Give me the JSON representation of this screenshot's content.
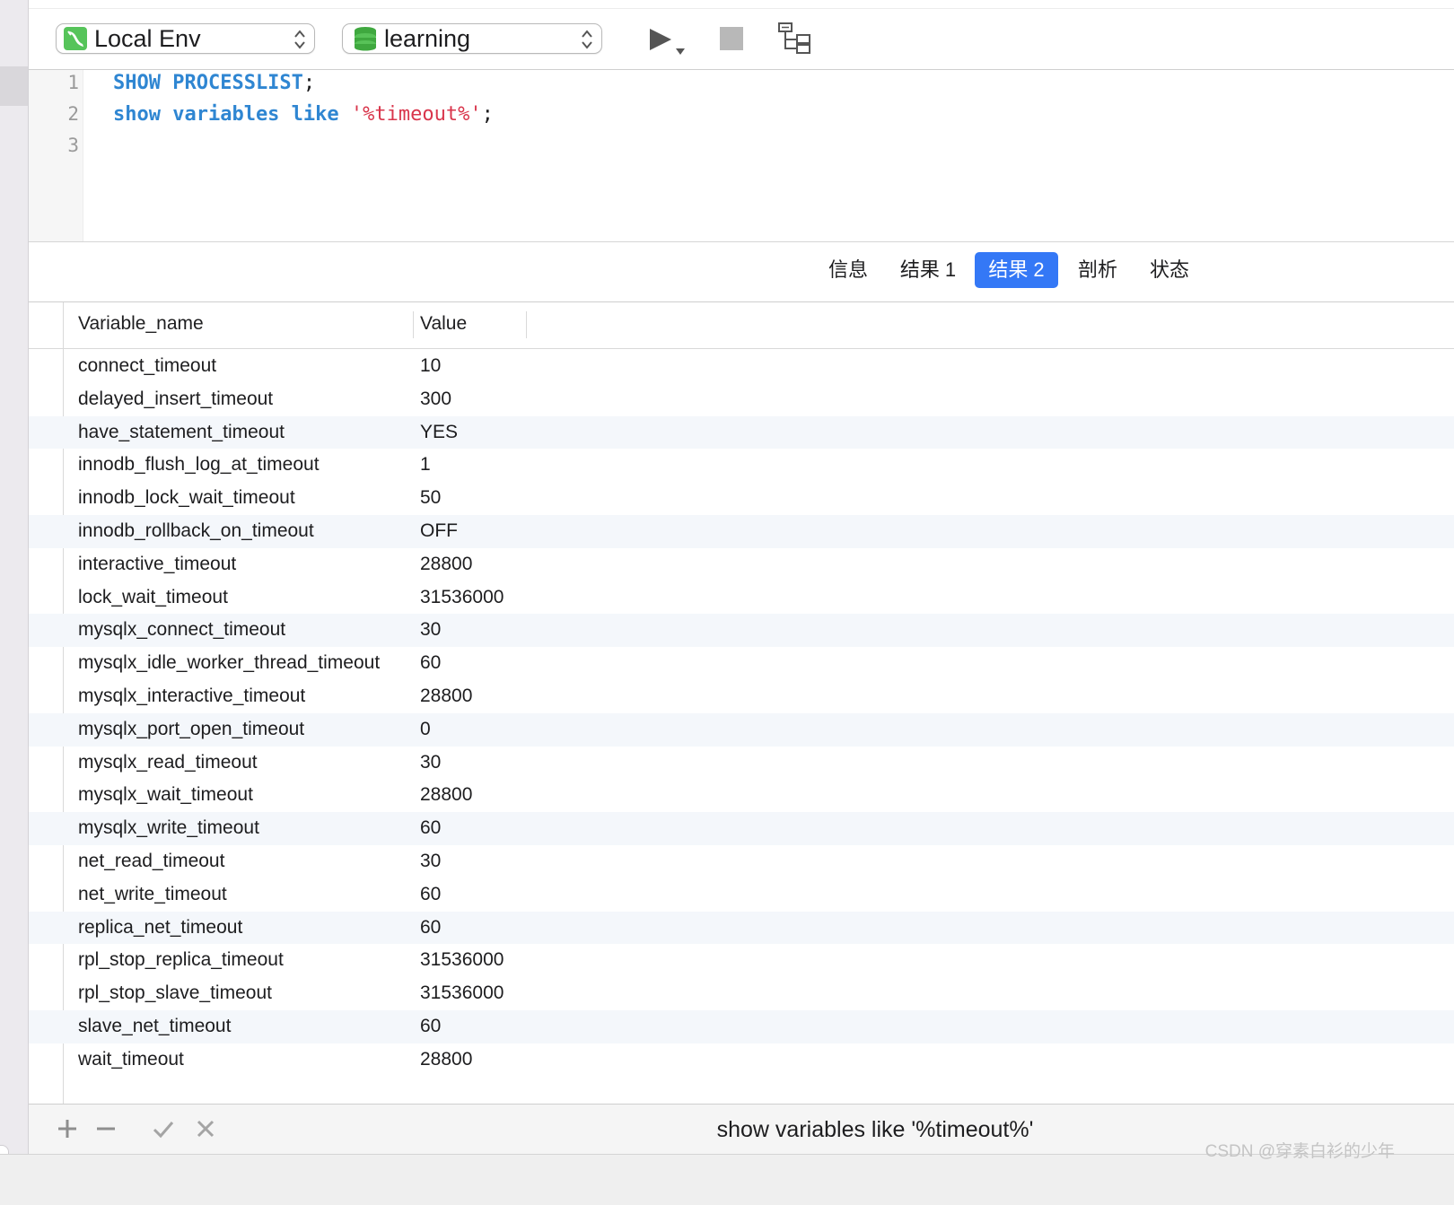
{
  "toolbar": {
    "connection": {
      "label": "Local Env",
      "icon": "mysql-dolphin-icon"
    },
    "database": {
      "label": "learning",
      "icon": "database-stack-icon"
    },
    "run_icon": "play-icon",
    "stop_icon": "stop-icon",
    "explain_icon": "explain-tree-icon"
  },
  "editor": {
    "lines": [
      {
        "number": "1",
        "tokens": [
          {
            "t": "SHOW PROCESSLIST",
            "k": "kw"
          },
          {
            "t": ";",
            "k": ""
          }
        ]
      },
      {
        "number": "2",
        "tokens": [
          {
            "t": "show variables like",
            "k": "kw"
          },
          {
            "t": " ",
            "k": ""
          },
          {
            "t": "'%timeout%'",
            "k": "str"
          },
          {
            "t": ";",
            "k": ""
          }
        ]
      },
      {
        "number": "3",
        "tokens": []
      }
    ]
  },
  "tabs": [
    {
      "label": "信息",
      "active": false
    },
    {
      "label": "结果 1",
      "active": false
    },
    {
      "label": "结果 2",
      "active": true
    },
    {
      "label": "剖析",
      "active": false
    },
    {
      "label": "状态",
      "active": false
    }
  ],
  "table": {
    "columns": [
      "Variable_name",
      "Value"
    ],
    "rows": [
      [
        "connect_timeout",
        "10"
      ],
      [
        "delayed_insert_timeout",
        "300"
      ],
      [
        "have_statement_timeout",
        "YES"
      ],
      [
        "innodb_flush_log_at_timeout",
        "1"
      ],
      [
        "innodb_lock_wait_timeout",
        "50"
      ],
      [
        "innodb_rollback_on_timeout",
        "OFF"
      ],
      [
        "interactive_timeout",
        "28800"
      ],
      [
        "lock_wait_timeout",
        "31536000"
      ],
      [
        "mysqlx_connect_timeout",
        "30"
      ],
      [
        "mysqlx_idle_worker_thread_timeout",
        "60"
      ],
      [
        "mysqlx_interactive_timeout",
        "28800"
      ],
      [
        "mysqlx_port_open_timeout",
        "0"
      ],
      [
        "mysqlx_read_timeout",
        "30"
      ],
      [
        "mysqlx_wait_timeout",
        "28800"
      ],
      [
        "mysqlx_write_timeout",
        "60"
      ],
      [
        "net_read_timeout",
        "30"
      ],
      [
        "net_write_timeout",
        "60"
      ],
      [
        "replica_net_timeout",
        "60"
      ],
      [
        "rpl_stop_replica_timeout",
        "31536000"
      ],
      [
        "rpl_stop_slave_timeout",
        "31536000"
      ],
      [
        "slave_net_timeout",
        "60"
      ],
      [
        "wait_timeout",
        "28800"
      ]
    ]
  },
  "statusbar": {
    "query_text": "show variables like '%timeout%'",
    "icons": [
      "add-row-icon",
      "remove-row-icon",
      "apply-check-icon",
      "discard-x-icon"
    ]
  },
  "watermark": "CSDN @穿素白衫的少年",
  "colors": {
    "keyword": "#2f86d2",
    "string": "#d9364c",
    "active_tab": "#3478f6",
    "alt_row": "#f4f7fb"
  }
}
